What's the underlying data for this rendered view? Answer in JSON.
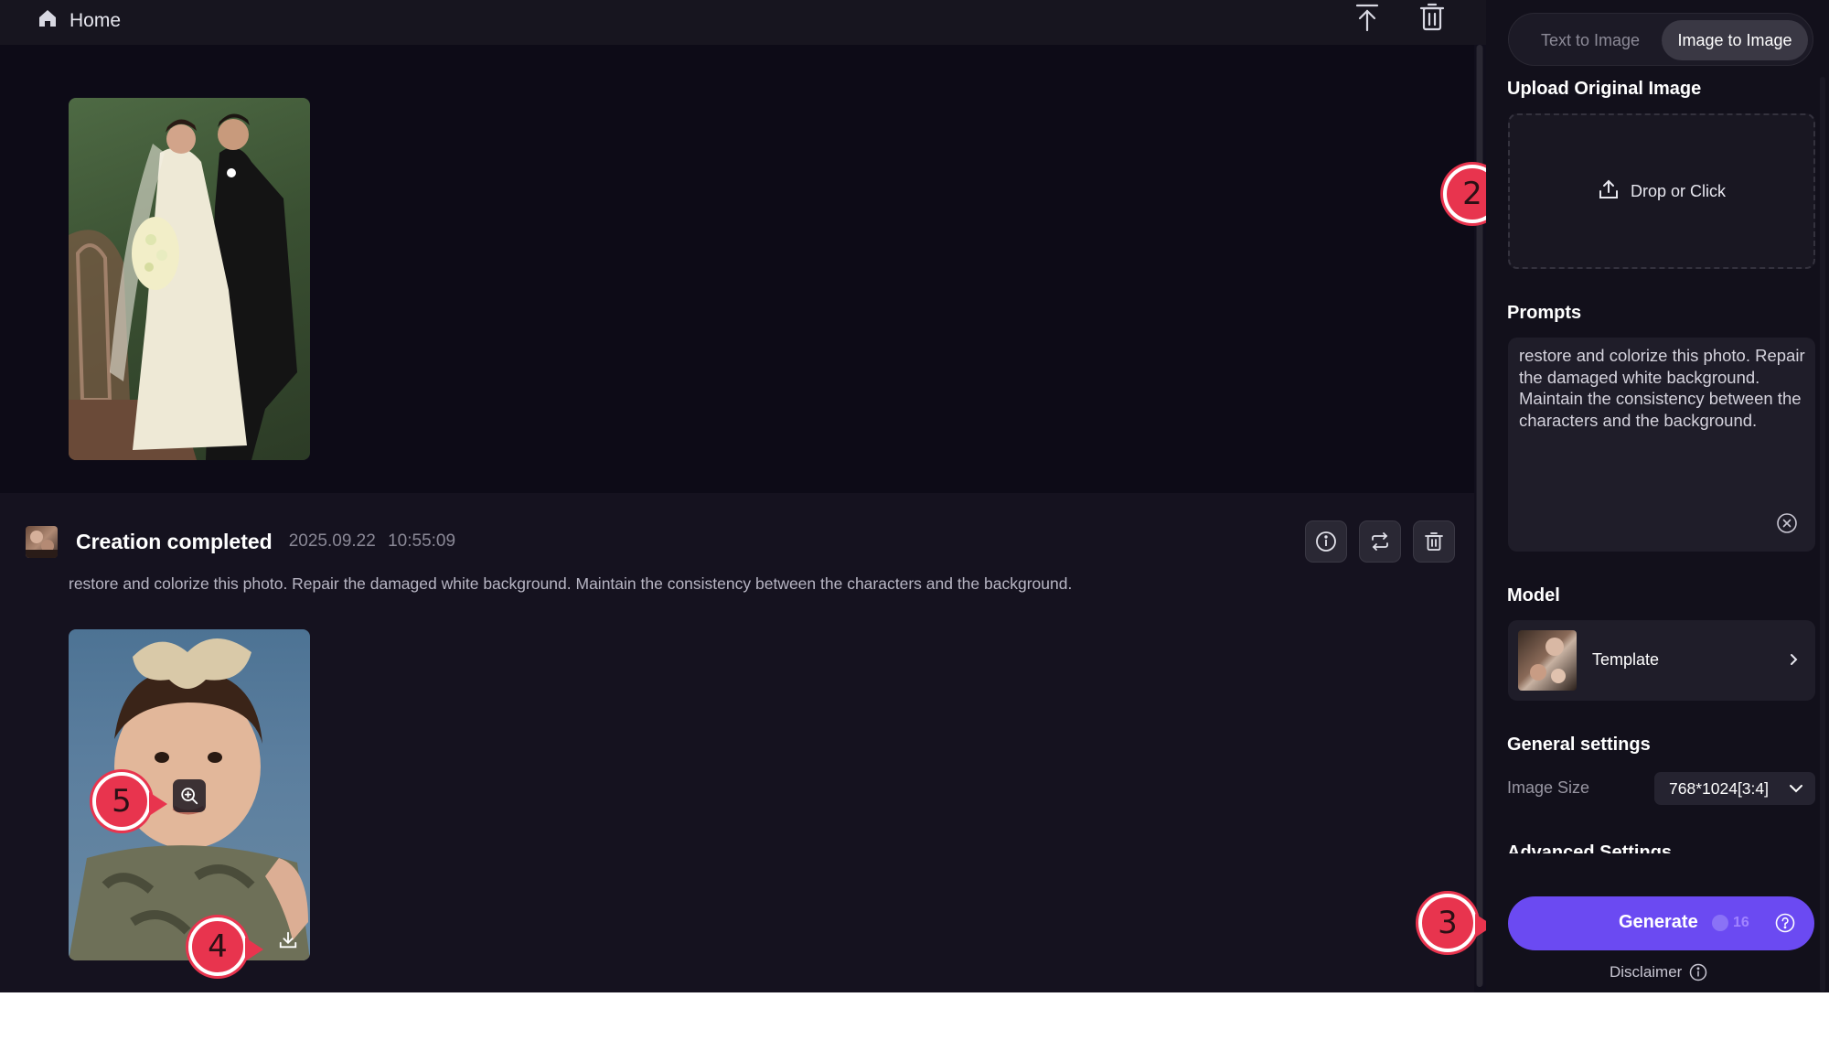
{
  "topbar": {
    "home_label": "Home",
    "icons": [
      "home-icon",
      "scroll-to-top-icon",
      "trash-icon"
    ]
  },
  "creation": {
    "status": "Creation completed",
    "timestamp": "2025.09.22  10:55:09",
    "prompt": "restore and colorize this photo. Repair the damaged white background. Maintain the consistency between the characters and the background.",
    "actions": [
      "info-icon",
      "regenerate-icon",
      "delete-icon"
    ]
  },
  "callouts": [
    "2",
    "3",
    "4",
    "5"
  ],
  "panel": {
    "tabs": {
      "text_to_image": "Text to Image",
      "image_to_image": "Image to Image",
      "active": "Image to Image"
    },
    "upload": {
      "title": "Upload Original Image",
      "button": "Drop or Click"
    },
    "prompts": {
      "title": "Prompts",
      "value": "restore and colorize this photo. Repair the damaged white background. Maintain the consistency between the characters and the background."
    },
    "model": {
      "title": "Model",
      "name": "Template"
    },
    "general": {
      "title": "General settings",
      "image_size_label": "Image Size",
      "image_size_value": "768*1024[3:4]"
    },
    "advanced_title": "Advanced Settings",
    "generate": {
      "label": "Generate",
      "cost": "16"
    },
    "disclaimer": "Disclaimer"
  },
  "colors": {
    "accent": "#6b4af2",
    "callout": "#e8344e",
    "background": "#110f1c",
    "panel": "#12101b"
  }
}
